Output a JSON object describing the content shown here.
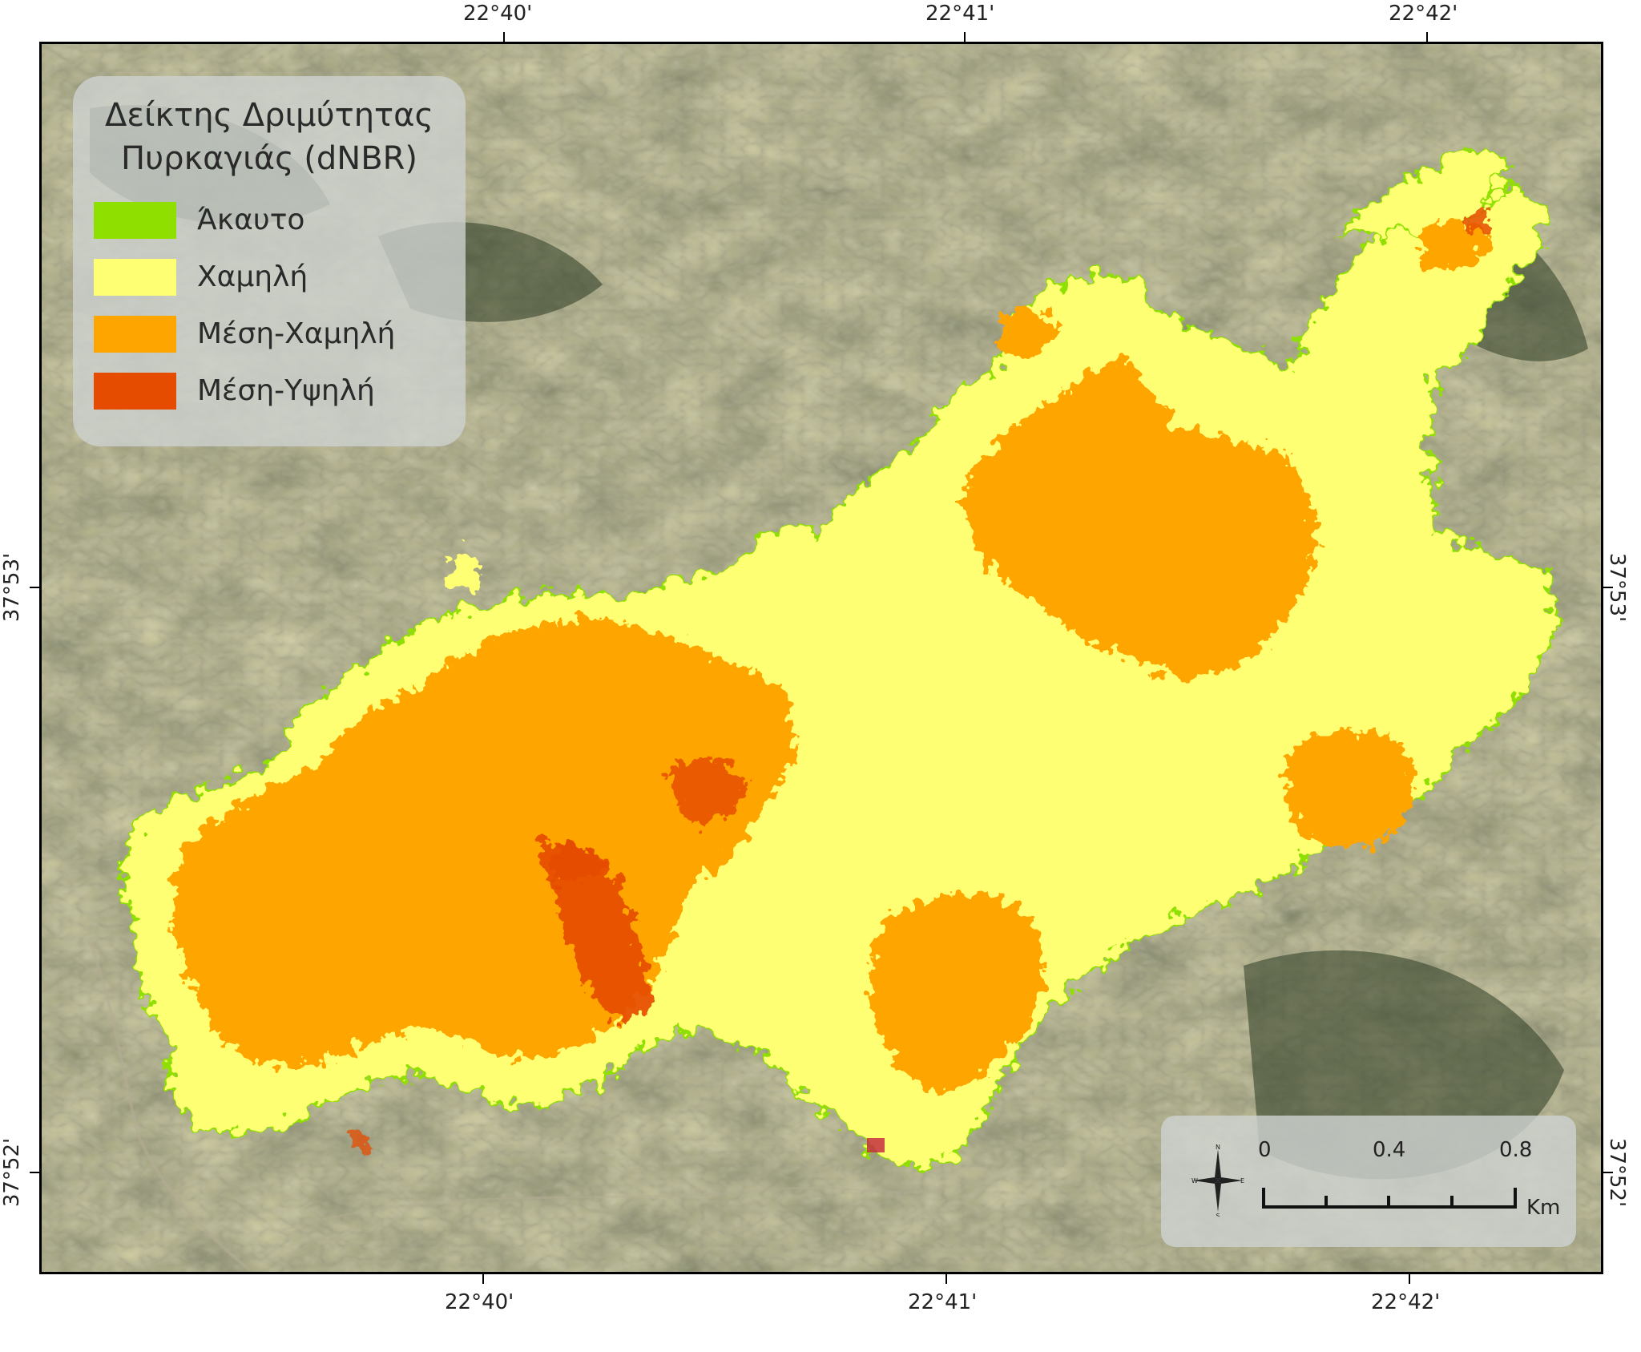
{
  "map": {
    "lon_ticks_top": [
      "22°40'",
      "22°41'",
      "22°42'"
    ],
    "lon_ticks_bottom": [
      "22°40'",
      "22°41'",
      "22°42'"
    ],
    "lat_ticks_left": [
      "37°53'",
      "37°52'"
    ],
    "lat_ticks_right": [
      "37°53'",
      "37°52'"
    ]
  },
  "legend": {
    "title": "Δείκτης Δριμύτητας\nΠυρκαγιάς (dNBR)",
    "items": [
      {
        "label": "Άκαυτο",
        "color": "#8fe000"
      },
      {
        "label": "Χαμηλή",
        "color": "#ffff73"
      },
      {
        "label": "Μέση-Χαμηλή",
        "color": "#ffa500"
      },
      {
        "label": "Μέση-Υψηλή",
        "color": "#e64c00"
      }
    ]
  },
  "scale_bar": {
    "labels": [
      "0",
      "0.4",
      "0.8"
    ],
    "unit": "Km",
    "compass": {
      "n": "N",
      "s": "S",
      "e": "E",
      "w": "W"
    }
  },
  "colors": {
    "unburned": "#8fe000",
    "low": "#ffff73",
    "moderate_low": "#ffa500",
    "moderate_high": "#e64c00"
  }
}
